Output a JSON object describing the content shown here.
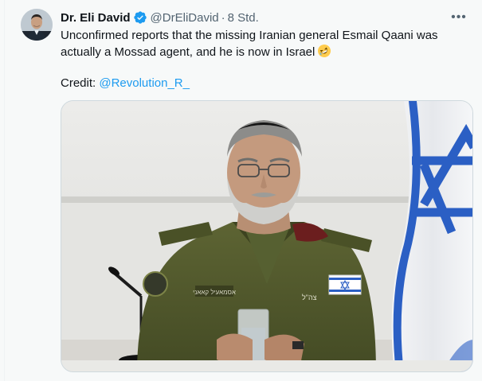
{
  "author": {
    "name": "Dr. Eli David",
    "handle": "@DrEliDavid",
    "separator": "·",
    "time": "8 Std."
  },
  "tweet": {
    "text": "Unconfirmed reports that the missing Iranian general Esmail Qaani was actually a Mossad agent, and he is now in Israel",
    "emoji_icon": "rolling-on-floor-laughing-emoji",
    "credit_label": "Credit:",
    "credit_handle": "@Revolution_R_"
  },
  "media": {
    "shirt_label": "צה\"ל",
    "name_tag": "אסמאעיל קאאני"
  },
  "colors": {
    "link": "#1d9bf0",
    "verified": "#1d9bf0",
    "secondary_text": "#536471"
  },
  "icons": [
    "verified-badge-icon",
    "more-options-icon"
  ]
}
